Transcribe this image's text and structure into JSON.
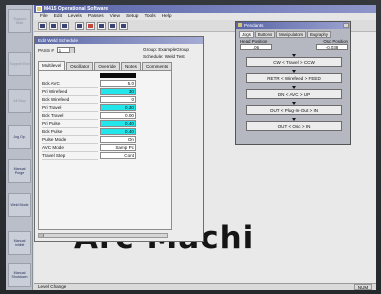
{
  "sidebar": {
    "items": [
      {
        "label": "Support Start"
      },
      {
        "label": "Support End"
      },
      {
        "label": "All Stop"
      },
      {
        "label": "Jog Op."
      },
      {
        "label": "Manual Purge"
      },
      {
        "label": "Weld Mode"
      },
      {
        "label": "Manual Inhibit"
      },
      {
        "label": "Manual Shutdown"
      }
    ]
  },
  "app": {
    "title": "M415 Operational Software",
    "menu": [
      "File",
      "Edit",
      "Levels",
      "Passes",
      "View",
      "Setup",
      "Tools",
      "Help"
    ],
    "toolbar_icons": [
      "open-icon",
      "save-icon",
      "print-icon",
      "document-icon",
      "stop-icon",
      "weld-icon",
      "copy-icon",
      "help-icon"
    ]
  },
  "weld_window": {
    "title": "Edit Weld Schedule",
    "pass_label": "PASS #",
    "pass_value": "1",
    "group": "Group: ExampleGroup",
    "schedule": "Schedule: Weld Test",
    "tabs": [
      "Multilevel",
      "Oscillator",
      "Override",
      "Notes",
      "Comments"
    ],
    "params": [
      {
        "label": "Bck AVC",
        "value": "5.0",
        "highlight": false
      },
      {
        "label": "Pri Wirefeed",
        "value": "30",
        "highlight": true
      },
      {
        "label": "Bck Wirefeed",
        "value": "0",
        "highlight": false
      },
      {
        "label": "Pri Travel",
        "value": "0.30",
        "highlight": true
      },
      {
        "label": "Bck Travel",
        "value": "0.00",
        "highlight": false
      },
      {
        "label": "Pri Pulse",
        "value": "0.40",
        "highlight": true
      },
      {
        "label": "Bck Pulse",
        "value": "0.40",
        "highlight": true
      },
      {
        "label": "Pulse Mode",
        "value": "On",
        "highlight": false
      },
      {
        "label": "AVC Mode",
        "value": "Samp Pc",
        "highlight": false
      },
      {
        "label": "Travel Step",
        "value": "Cont",
        "highlight": false
      }
    ]
  },
  "background_text": "Arc Machi",
  "pendant": {
    "title": "Pendants",
    "tabs": [
      "Jogs",
      "Buttons",
      "Manipulators",
      "Bugraphy"
    ],
    "head_position_label": "Head Position",
    "osc_position_label": "Osc Position",
    "head_position_value": ".06",
    "osc_position_value": "-0.038",
    "buttons": [
      "CW < Travel > CCW",
      "RETR < Wirefeed > FEED",
      "DN < AVC > UP",
      "OUT < Plug-In-Out > IN",
      "OUT < Osc > IN"
    ]
  },
  "status": {
    "left": "Level Change",
    "right": "NUM"
  }
}
